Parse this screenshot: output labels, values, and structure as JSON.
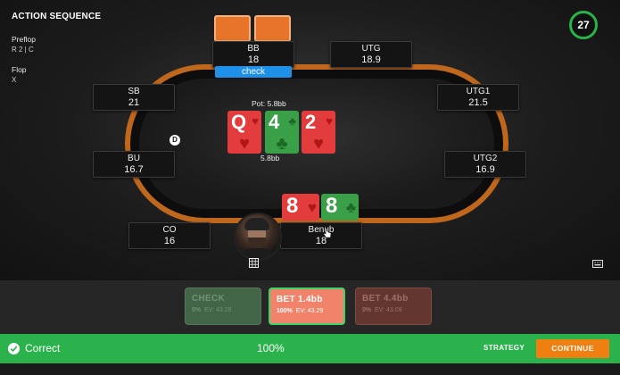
{
  "sequence": {
    "title": "ACTION SEQUENCE",
    "streets": [
      {
        "label": "Preflop",
        "actions": "R 2  |  C"
      },
      {
        "label": "Flop",
        "actions": "X"
      }
    ]
  },
  "timer": "27",
  "seats": {
    "bb": {
      "name": "BB",
      "stack": "18",
      "action": "check"
    },
    "utg": {
      "name": "UTG",
      "stack": "18.9"
    },
    "sb": {
      "name": "SB",
      "stack": "21"
    },
    "utg1": {
      "name": "UTG1",
      "stack": "21.5"
    },
    "bu": {
      "name": "BU",
      "stack": "16.7"
    },
    "utg2": {
      "name": "UTG2",
      "stack": "16.9"
    },
    "co": {
      "name": "CO",
      "stack": "16"
    },
    "hero": {
      "name": "Benub",
      "stack": "18"
    }
  },
  "dealer_button": "D",
  "pot": {
    "label": "Pot: 5.8bb",
    "sub": "5.8bb"
  },
  "board": [
    {
      "rank": "Q",
      "suit": "♥",
      "color": "red"
    },
    {
      "rank": "4",
      "suit": "♣",
      "color": "green"
    },
    {
      "rank": "2",
      "suit": "♥",
      "color": "red"
    }
  ],
  "hero_cards": [
    {
      "rank": "8",
      "suit": "♥",
      "color": "red"
    },
    {
      "rank": "8",
      "suit": "♣",
      "color": "green"
    }
  ],
  "actions": [
    {
      "label": "CHECK",
      "freq": "0%",
      "ev": "EV: 43.29"
    },
    {
      "label": "BET 1.4bb",
      "freq": "100%",
      "ev": "EV: 43.29"
    },
    {
      "label": "BET 4.4bb",
      "freq": "0%",
      "ev": "EV: 43.09"
    }
  ],
  "status": {
    "result": "Correct",
    "score": "100%",
    "strategy": "STRATEGY",
    "continue": "CONTINUE"
  },
  "colors": {
    "table_rail": "#c0671e",
    "check_pill": "#1e90e8",
    "correct_bar": "#2bb24c",
    "continue_button": "#f07f12",
    "selected_action": "#f2836b"
  }
}
